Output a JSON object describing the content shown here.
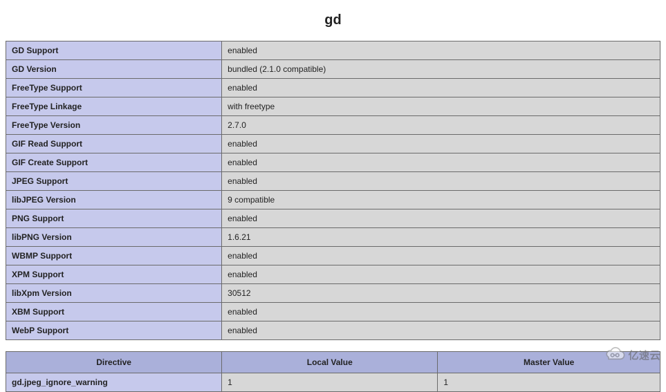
{
  "section_title": "gd",
  "info_rows": [
    {
      "label": "GD Support",
      "value": "enabled"
    },
    {
      "label": "GD Version",
      "value": "bundled (2.1.0 compatible)"
    },
    {
      "label": "FreeType Support",
      "value": "enabled"
    },
    {
      "label": "FreeType Linkage",
      "value": "with freetype"
    },
    {
      "label": "FreeType Version",
      "value": "2.7.0"
    },
    {
      "label": "GIF Read Support",
      "value": "enabled"
    },
    {
      "label": "GIF Create Support",
      "value": "enabled"
    },
    {
      "label": "JPEG Support",
      "value": "enabled"
    },
    {
      "label": "libJPEG Version",
      "value": "9 compatible"
    },
    {
      "label": "PNG Support",
      "value": "enabled"
    },
    {
      "label": "libPNG Version",
      "value": "1.6.21"
    },
    {
      "label": "WBMP Support",
      "value": "enabled"
    },
    {
      "label": "XPM Support",
      "value": "enabled"
    },
    {
      "label": "libXpm Version",
      "value": "30512"
    },
    {
      "label": "XBM Support",
      "value": "enabled"
    },
    {
      "label": "WebP Support",
      "value": "enabled"
    }
  ],
  "directive_table": {
    "headers": {
      "directive": "Directive",
      "local": "Local Value",
      "master": "Master Value"
    },
    "rows": [
      {
        "directive": "gd.jpeg_ignore_warning",
        "local": "1",
        "master": "1"
      }
    ]
  },
  "watermark_text": "亿速云"
}
